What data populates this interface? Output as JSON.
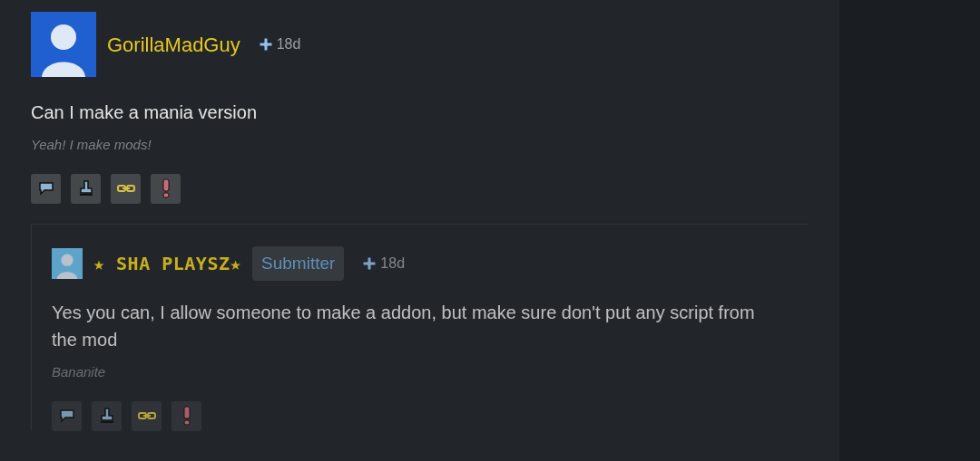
{
  "comments": [
    {
      "author": "GorillaMadGuy",
      "kind": "plain",
      "time": "18d",
      "body": "Can I make a mania version",
      "signature": "Yeah! I make mods!",
      "dimmed": false,
      "actions": [
        {
          "kind": "reply"
        },
        {
          "kind": "stamp"
        },
        {
          "kind": "link"
        },
        {
          "kind": "report"
        }
      ],
      "replies": [
        {
          "author": "★ SHA PLAYSZ★",
          "kind": "pixel",
          "badge": "Submitter",
          "time": "18d",
          "body": "Yes you can, I allow someone to make a addon, but make sure don't put any script from the mod",
          "signature": "Bananite",
          "dimmed": true,
          "actions": [
            {
              "kind": "reply"
            },
            {
              "kind": "stamp"
            },
            {
              "kind": "link"
            },
            {
              "kind": "report"
            }
          ]
        }
      ]
    }
  ]
}
